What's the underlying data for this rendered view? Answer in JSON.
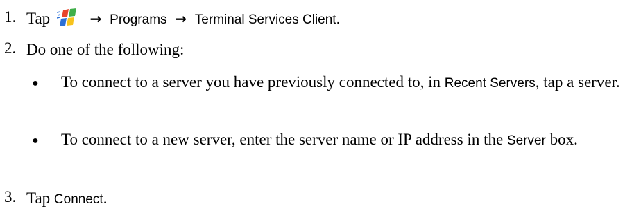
{
  "steps": [
    {
      "number": "1.",
      "prefix": "Tap",
      "icon": "windows-start-flag-icon",
      "menu_1": "Programs",
      "menu_2": "Terminal Services Client",
      "suffix": "."
    },
    {
      "number": "2.",
      "text": "Do one of the following:",
      "bullets": [
        {
          "text_1": "To connect to a server you have previously connected to, in ",
          "ui_label": "Recent Servers",
          "text_2": ", tap a server."
        },
        {
          "text_1": "To connect to a new server, enter the server name or IP address in the ",
          "ui_label": "Server",
          "text_2": " box."
        }
      ]
    },
    {
      "number": "3.",
      "prefix": "Tap ",
      "ui_label": "Connect",
      "suffix": "."
    }
  ],
  "symbols": {
    "arrow": "→",
    "bullet": "●"
  },
  "colors": {
    "flag_red": "#e8442b",
    "flag_green": "#3fae49",
    "flag_blue": "#2b6fd6",
    "flag_yellow": "#f7c31d"
  }
}
